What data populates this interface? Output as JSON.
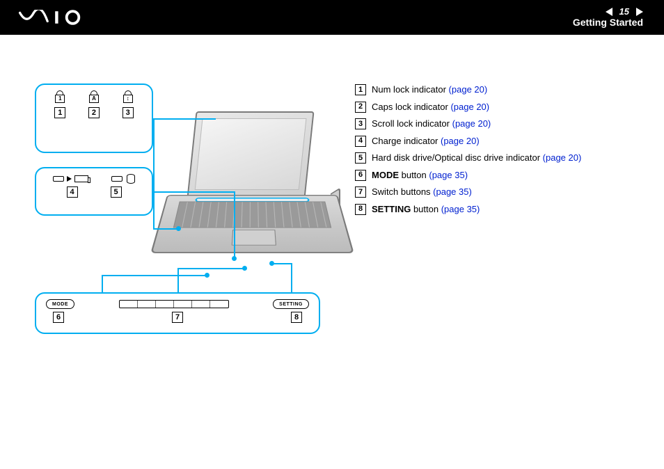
{
  "header": {
    "logo_alt": "VAIO",
    "page_number": "15",
    "section": "Getting Started"
  },
  "callouts": {
    "top_icons": [
      "1",
      "A",
      "↕"
    ],
    "top_numbers": [
      "1",
      "2",
      "3"
    ],
    "mid_numbers": [
      "4",
      "5"
    ],
    "bottom": {
      "mode_label": "MODE",
      "setting_label": "SETTING",
      "numbers": [
        "6",
        "7",
        "8"
      ]
    }
  },
  "legend": [
    {
      "n": "1",
      "text_pre": "Num lock indicator ",
      "link": "(page 20)"
    },
    {
      "n": "2",
      "text_pre": "Caps lock indicator ",
      "link": "(page 20)"
    },
    {
      "n": "3",
      "text_pre": "Scroll lock indicator ",
      "link": "(page 20)"
    },
    {
      "n": "4",
      "text_pre": "Charge indicator ",
      "link": "(page 20)"
    },
    {
      "n": "5",
      "text_pre": "Hard disk drive/Optical disc drive indicator ",
      "link": "(page 20)"
    },
    {
      "n": "6",
      "bold": "MODE",
      "text_pre": " button ",
      "link": "(page 35)"
    },
    {
      "n": "7",
      "text_pre": "Switch buttons ",
      "link": "(page 35)"
    },
    {
      "n": "8",
      "bold": "SETTING",
      "text_pre": " button ",
      "link": "(page 35)"
    }
  ]
}
